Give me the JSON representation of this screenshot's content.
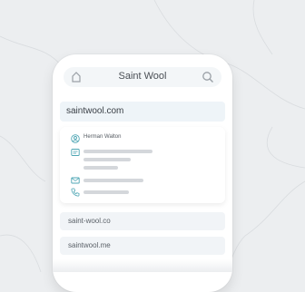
{
  "header": {
    "title": "Saint Wool"
  },
  "primary_domain": "saintwool.com",
  "owner": {
    "name": "Herman Walton"
  },
  "other_domains": [
    "saint-wool.co",
    "saintwool.me"
  ],
  "colors": {
    "accent": "#4ea6b4",
    "background": "#eceef0"
  }
}
